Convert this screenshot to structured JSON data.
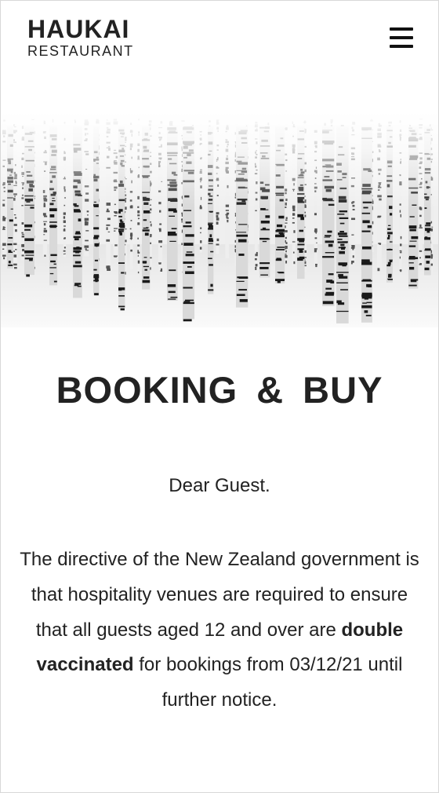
{
  "header": {
    "logo_main": "HAUKAI",
    "logo_sub": "RESTAURANT",
    "menu_icon": "hamburger-menu-icon"
  },
  "hero": {
    "image": "snowy-birch-forest-photo"
  },
  "main": {
    "title": "BOOKING & BUY",
    "greeting": "Dear Guest.",
    "notice_part1": "The directive of the New Zealand government is that hospitality venues are required to ensure that all guests aged 12 and over are ",
    "notice_bold1": "double",
    "notice_bold2": "vaccinated",
    "notice_part2": " for bookings from 03/12/21 until further notice."
  },
  "colors": {
    "text": "#222222",
    "background": "#ffffff",
    "border": "#d8d8d8"
  }
}
